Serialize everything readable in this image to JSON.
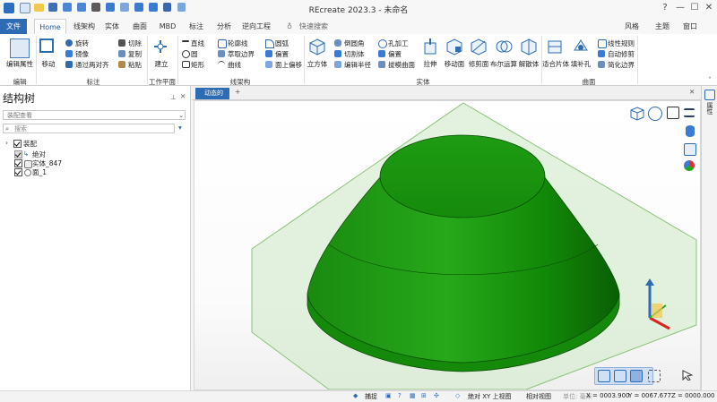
{
  "app_title": "REcreate 2023.3 - 未命名",
  "title_right": {
    "style": "风格",
    "theme": "主题",
    "window": "窗口"
  },
  "tabs": [
    {
      "label": "文件"
    },
    {
      "label": "Home"
    },
    {
      "label": "线架构"
    },
    {
      "label": "实体"
    },
    {
      "label": "曲面"
    },
    {
      "label": "MBD"
    },
    {
      "label": "标注"
    },
    {
      "label": "分析"
    },
    {
      "label": "逆向工程"
    }
  ],
  "search_placeholder": "快速搜索",
  "ribbon": {
    "edit_props": "编辑属性",
    "move": "移动",
    "rotate": "旋转",
    "mirror": "镜像",
    "via_two_planes": "通过两对齐",
    "cut": "切除",
    "copy": "复制",
    "paste": "粘贴",
    "create": "建立",
    "line": "直线",
    "circle": "圆",
    "rectangle": "矩形",
    "arc": "圆弧",
    "curve": "曲线",
    "contour_line": "轮廓线",
    "extract_edge": "萃取边界",
    "offset": "偏置",
    "face_offset": "面上偏移",
    "fillet": "圆角",
    "cube": "立方体",
    "chamfer": "倒圆角",
    "cut_body": "切割体",
    "edit_radius": "编辑半径",
    "hole_feature": "孔加工",
    "shell": "偏置",
    "loft_surface": "拔模曲面",
    "extrude": "拉伸",
    "move_face": "移动面",
    "trim_face": "修剪面",
    "boolean": "布尔运算",
    "split_body": "解散体",
    "fit_body": "适合片体",
    "fill_hole": "填补孔",
    "line_rule": "线性规则",
    "auto_trim": "自动修剪",
    "simplify_edge": "简化边界"
  },
  "groups": {
    "edit": "编辑",
    "label": "标注",
    "work_plane": "工作平面",
    "wireframe": "线架构",
    "solid": "实体",
    "surface": "曲面"
  },
  "tree": {
    "title": "结构树",
    "select_value": "装配查看",
    "search_placeholder": "搜索",
    "root": "装配",
    "items": [
      {
        "label": "绝对"
      },
      {
        "label": "实体_847"
      },
      {
        "label": "面_1"
      }
    ]
  },
  "viewport_tab": "动态的",
  "right_bar_label": "属性",
  "status": {
    "snap": "捕捉",
    "abs_xy": "绝对 XY 上视图",
    "rel_view": "相对视图",
    "units": "单位: 毫米",
    "x": "X = 0003.900",
    "y": "Y = 0067.677",
    "z": "Z = 0000.000"
  },
  "colors": {
    "accent": "#2e6bb5",
    "solid_green": "#1f9a12",
    "plane_green": "#cfe8c6"
  }
}
